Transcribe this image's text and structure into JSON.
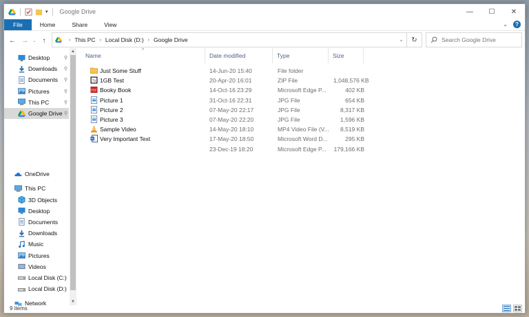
{
  "window": {
    "title": "Google Drive"
  },
  "ribbon": {
    "tabs": [
      "File",
      "Home",
      "Share",
      "View"
    ],
    "help": "?"
  },
  "address": {
    "breadcrumbs": [
      "This PC",
      "Local Disk (D:)",
      "Google Drive"
    ]
  },
  "search": {
    "placeholder": "Search Google Drive"
  },
  "columns": {
    "name": "Name",
    "date": "Date modified",
    "type": "Type",
    "size": "Size"
  },
  "nav": {
    "quick_access": [
      {
        "label": "Desktop",
        "icon": "desktop-icon",
        "pinned": true
      },
      {
        "label": "Downloads",
        "icon": "downloads-icon",
        "pinned": true
      },
      {
        "label": "Documents",
        "icon": "documents-icon",
        "pinned": true
      },
      {
        "label": "Pictures",
        "icon": "pictures-icon",
        "pinned": true
      },
      {
        "label": "This PC",
        "icon": "this-pc-icon",
        "pinned": true
      },
      {
        "label": "Google Drive",
        "icon": "google-drive-icon",
        "pinned": true
      }
    ],
    "onedrive": "OneDrive",
    "this_pc": "This PC",
    "this_pc_items": [
      {
        "label": "3D Objects",
        "icon": "3d-objects-icon"
      },
      {
        "label": "Desktop",
        "icon": "desktop-icon"
      },
      {
        "label": "Documents",
        "icon": "documents-icon"
      },
      {
        "label": "Downloads",
        "icon": "downloads-icon"
      },
      {
        "label": "Music",
        "icon": "music-icon"
      },
      {
        "label": "Pictures",
        "icon": "pictures-icon"
      },
      {
        "label": "Videos",
        "icon": "videos-icon"
      },
      {
        "label": "Local Disk (C:)",
        "icon": "drive-icon"
      },
      {
        "label": "Local Disk (D:)",
        "icon": "drive-icon"
      }
    ],
    "network": "Network"
  },
  "files": [
    {
      "name": "Just Some Stuff",
      "date": "14-Jun-20 15:40",
      "type": "File folder",
      "size": "",
      "icon": "folder-icon"
    },
    {
      "name": "1GB Test",
      "date": "20-Apr-20 16:01",
      "type": "ZIP File",
      "size": "1,048,576 KB",
      "icon": "zip-file-icon"
    },
    {
      "name": "Booky Book",
      "date": "14-Oct-16 23:29",
      "type": "Microsoft Edge P...",
      "size": "402 KB",
      "icon": "pdf-file-icon"
    },
    {
      "name": "Picture 1",
      "date": "31-Oct-16 22:31",
      "type": "JPG File",
      "size": "654 KB",
      "icon": "image-file-icon"
    },
    {
      "name": "Picture 2",
      "date": "07-May-20 22:17",
      "type": "JPG File",
      "size": "8,317 KB",
      "icon": "image-file-icon"
    },
    {
      "name": "Picture 3",
      "date": "07-May-20 22:20",
      "type": "JPG File",
      "size": "1,596 KB",
      "icon": "image-file-icon"
    },
    {
      "name": "Sample Video",
      "date": "14-May-20 18:10",
      "type": "MP4 Video File (V...",
      "size": "8,519 KB",
      "icon": "vlc-video-icon"
    },
    {
      "name": "Very Important Text",
      "date": "17-May-20 18:50",
      "type": "Microsoft Word D...",
      "size": "295 KB",
      "icon": "word-doc-icon"
    },
    {
      "name": "",
      "date": "23-Dec-19 18:20",
      "type": "Microsoft Edge P...",
      "size": "179,166 KB",
      "icon": ""
    }
  ],
  "status": {
    "count": "9 items"
  },
  "colors": {
    "accent": "#1a6fb3",
    "folder": "#f3c552",
    "selected": "#d9d9d9"
  }
}
